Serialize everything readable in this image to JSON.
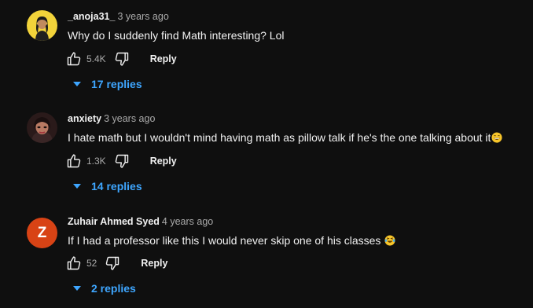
{
  "comments": [
    {
      "author": "_anoja31_",
      "time": "3 years ago",
      "text": "Why do I suddenly find Math interesting? Lol",
      "likes": "5.4K",
      "reply_label": "Reply",
      "replies_label": "17 replies",
      "avatar_icon": "user-photo-avatar"
    },
    {
      "author": "anxiety",
      "time": "3 years ago",
      "text": "I hate math but I wouldn't mind having math as pillow talk if he's the one talking about it",
      "emoji": "grinning-face-emoji",
      "likes": "1.3K",
      "reply_label": "Reply",
      "replies_label": "14 replies",
      "avatar_icon": "user-photo-avatar"
    },
    {
      "author": "Zuhair Ahmed Syed",
      "time": "4 years ago",
      "text": "If I had a professor like this I would never skip one of his classes",
      "emoji": "laughing-tears-emoji",
      "likes": "52",
      "reply_label": "Reply",
      "replies_label": "2 replies",
      "avatar_letter": "Z",
      "avatar_color": "#d84315"
    }
  ],
  "colors": {
    "background": "#0f0f0f",
    "link_blue": "#3ea6ff",
    "secondary_text": "#aaaaaa"
  }
}
